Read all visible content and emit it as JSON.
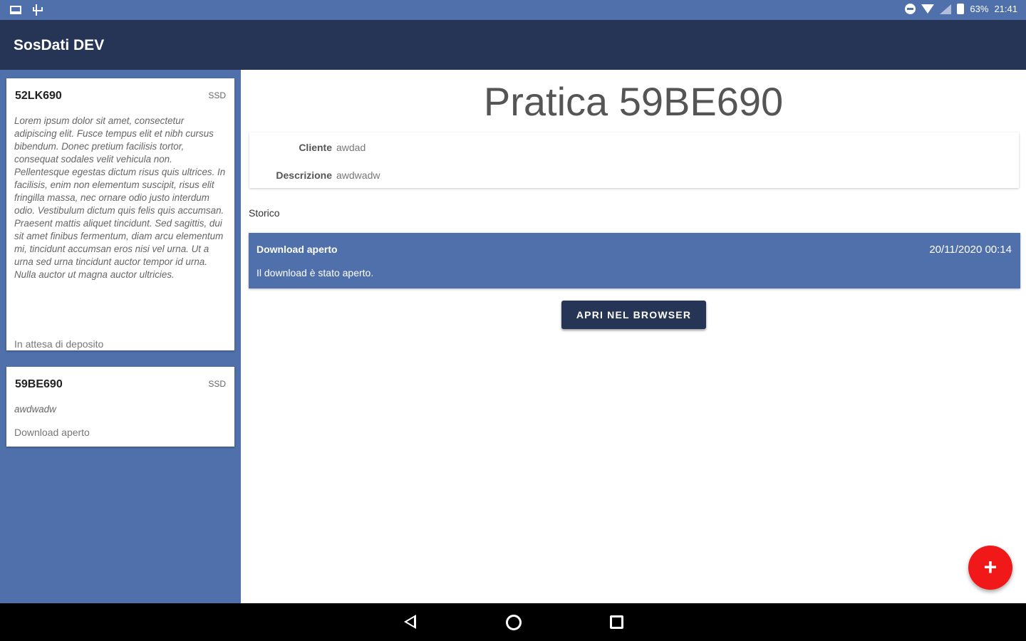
{
  "status_bar": {
    "battery": "63%",
    "time": "21:41"
  },
  "app_bar": {
    "title": "SosDati DEV"
  },
  "sidebar": {
    "cards": [
      {
        "code": "52LK690",
        "tag": "SSD",
        "description": "Lorem ipsum dolor sit amet, consectetur adipiscing elit. Fusce tempus elit et nibh cursus bibendum. Donec pretium facilisis tortor, consequat sodales velit vehicula non. Pellentesque egestas dictum risus quis ultrices. In facilisis, enim non elementum suscipit, risus elit fringilla massa, nec ornare odio justo interdum odio. Vestibulum dictum quis felis quis accumsan. Praesent mattis aliquet tincidunt. Sed sagittis, dui sit amet finibus fermentum, diam arcu elementum mi, tincidunt accumsan eros nisi vel urna. Ut a urna sed urna tincidunt auctor tempor id urna. Nulla auctor ut magna auctor ultricies.",
        "status": "In attesa di deposito"
      },
      {
        "code": "59BE690",
        "tag": "SSD",
        "description": "awdwadw",
        "status": "Download aperto"
      }
    ]
  },
  "main": {
    "title": "Pratica 59BE690",
    "info": {
      "client_label": "Cliente",
      "client_value": "awdad",
      "description_label": "Descrizione",
      "description_value": "awdwadw"
    },
    "history_label": "Storico",
    "history": [
      {
        "title": "Download aperto",
        "date": "20/11/2020 00:14",
        "description": "Il download è stato aperto."
      }
    ],
    "open_button_label": "APRI NEL BROWSER"
  },
  "fab": {
    "icon": "plus-icon",
    "symbol": "+"
  },
  "colors": {
    "primary": "#5070ab",
    "dark": "#263555",
    "fab": "#f01818"
  }
}
